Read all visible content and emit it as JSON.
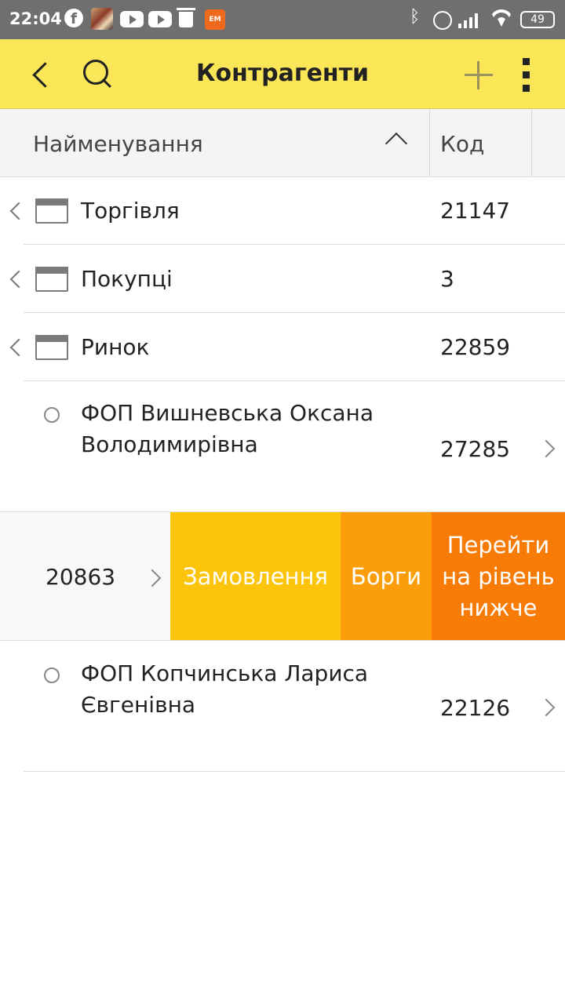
{
  "status_bar": {
    "time": "22:04",
    "battery": "49",
    "icons": [
      "facebook-icon",
      "game-avatar-icon",
      "youtube-icon",
      "youtube-icon",
      "trash-icon",
      "em-app-icon",
      "bluetooth-icon",
      "alarm-icon",
      "signal-icon",
      "wifi-icon",
      "battery-icon"
    ]
  },
  "app_bar": {
    "title": "Контрагенти",
    "icons": [
      "back-icon",
      "search-icon",
      "add-icon",
      "more-vert-icon"
    ]
  },
  "table": {
    "columns": {
      "name": "Найменування",
      "code": "Код"
    },
    "rows": [
      {
        "type": "folder",
        "label": "Торгівля",
        "code": "21147"
      },
      {
        "type": "folder",
        "label": "Покупці",
        "code": "3"
      },
      {
        "type": "folder",
        "label": "Ринок",
        "code": "22859"
      },
      {
        "type": "item",
        "label_line1": "ФОП Вишневська Оксана",
        "label_line2": "Володимирівна",
        "code": "27285"
      },
      {
        "type": "swiped",
        "code": "20863"
      },
      {
        "type": "item",
        "label_line1": "ФОП Копчинська Лариса",
        "label_line2": "Євгенівна",
        "code": "22126"
      }
    ]
  },
  "swipe_actions": {
    "orders": "Замовлення",
    "debts": "Борги",
    "go_down_line1": "Перейти",
    "go_down_line2": "на рівень",
    "go_down_line3": "нижче",
    "colors": {
      "orders": "#fcc40a",
      "debts": "#fb9e0a",
      "go_down": "#f87b06"
    }
  },
  "theme": {
    "appbar": "#fbe658",
    "statusbar": "#6f6f6f"
  }
}
